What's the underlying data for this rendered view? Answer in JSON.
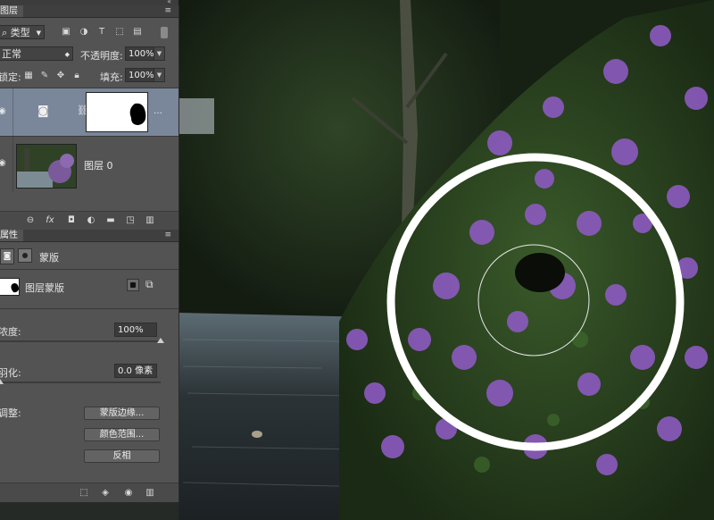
{
  "layers_panel": {
    "tab_title": "图层",
    "filter_kind": "类型",
    "blend_mode": "正常",
    "opacity_label": "不透明度:",
    "opacity_value": "100%",
    "lock_label": "锁定:",
    "fill_label": "填充:",
    "fill_value": "100%",
    "layers": [
      {
        "name": "",
        "type": "adjustment-with-mask"
      },
      {
        "name": "图层 0",
        "type": "image"
      }
    ],
    "bottom_icons": [
      "link-icon",
      "fx-icon",
      "add-mask-icon",
      "adjustment-icon",
      "group-icon",
      "new-layer-icon",
      "trash-icon"
    ]
  },
  "properties_panel": {
    "tab_title": "属性",
    "mask_type_label": "蒙版",
    "layer_mask_label": "图层蒙版",
    "density_label": "浓度:",
    "density_value": "100%",
    "density_level": 1.0,
    "feather_label": "羽化:",
    "feather_value": "0.0 像素",
    "feather_level": 0.0,
    "refine_label": "调整:",
    "buttons": {
      "mask_edge": "蒙版边缘...",
      "color_range": "颜色范围...",
      "invert": "反相"
    }
  },
  "colors": {
    "panel_bg": "#535353",
    "selected_layer": "#7a8699",
    "brush_ring": "#ffffff"
  }
}
